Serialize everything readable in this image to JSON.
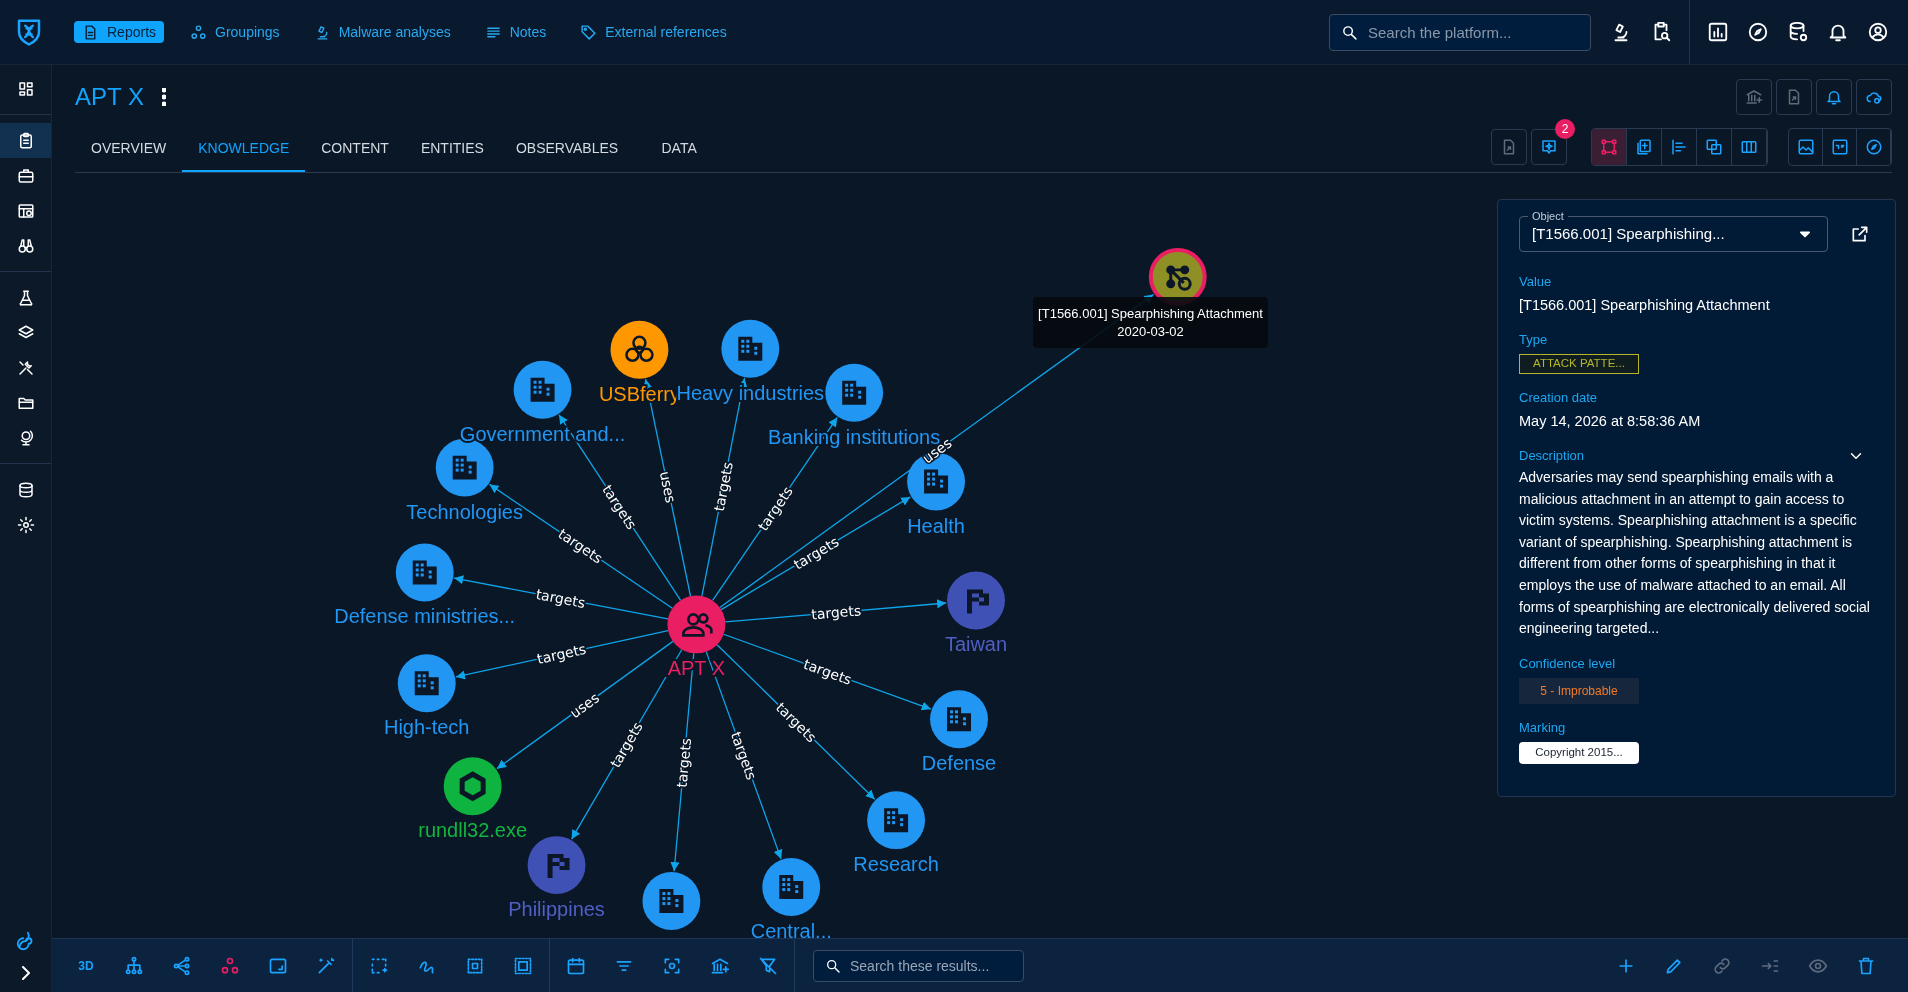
{
  "top_nav": {
    "items": [
      {
        "label": "Reports",
        "kind": "report",
        "selected": true
      },
      {
        "label": "Groupings",
        "kind": "circles",
        "selected": false
      },
      {
        "label": "Malware analyses",
        "kind": "microscope",
        "selected": false
      },
      {
        "label": "Notes",
        "kind": "lines",
        "selected": false
      },
      {
        "label": "External references",
        "kind": "tag",
        "selected": false
      }
    ],
    "search": {
      "placeholder": "Search the platform..."
    }
  },
  "sidebar": {
    "items": [
      {
        "kind": "dashboard",
        "selected": false
      },
      {
        "kind": "analyses",
        "selected": true
      },
      {
        "kind": "cases",
        "selected": false
      },
      {
        "kind": "events",
        "selected": false
      },
      {
        "kind": "observations",
        "selected": false
      },
      {
        "kind": "threats",
        "selected": false
      },
      {
        "kind": "arsenal",
        "selected": false
      },
      {
        "kind": "techniques",
        "selected": false
      },
      {
        "kind": "entities",
        "selected": false
      },
      {
        "kind": "locations",
        "selected": false
      },
      {
        "kind": "data",
        "selected": false
      },
      {
        "kind": "settings",
        "selected": false
      }
    ]
  },
  "report": {
    "title": "APT X",
    "actions": [
      {
        "kind": "bank-plus",
        "disabled": true
      },
      {
        "kind": "file-export",
        "disabled": true
      },
      {
        "kind": "bell",
        "disabled": false
      },
      {
        "kind": "cloud",
        "disabled": false
      }
    ]
  },
  "tabs": [
    {
      "label": "OVERVIEW",
      "selected": false
    },
    {
      "label": "KNOWLEDGE",
      "selected": true
    },
    {
      "label": "CONTENT",
      "selected": false
    },
    {
      "label": "ENTITIES",
      "selected": false
    },
    {
      "label": "OBSERVABLES",
      "selected": false
    },
    {
      "label": "DATA",
      "selected": false
    }
  ],
  "tab_tools": {
    "suggestions_badge": "2",
    "view_modes": [
      {
        "kind": "graph",
        "selected": true
      },
      {
        "kind": "content-mapping",
        "selected": false
      },
      {
        "kind": "timeline",
        "selected": false
      },
      {
        "kind": "correlation",
        "selected": false
      },
      {
        "kind": "matrix",
        "selected": false
      }
    ]
  },
  "graph": {
    "nodes": [
      {
        "kind": "threat-actor",
        "label": "APT X",
        "selected": false
      },
      {
        "kind": "malware",
        "label": "USBferry",
        "relation": "uses",
        "selected": false
      },
      {
        "kind": "sector",
        "label": "Heavy industries",
        "relation": "targets",
        "selected": false
      },
      {
        "kind": "sector",
        "label": "Government and...",
        "relation": "targets",
        "selected": false
      },
      {
        "kind": "sector",
        "label": "Banking institutions",
        "relation": "targets",
        "selected": false
      },
      {
        "kind": "sector",
        "label": "Technologies",
        "relation": "targets",
        "selected": false
      },
      {
        "kind": "sector",
        "label": "Health",
        "relation": "targets",
        "selected": false
      },
      {
        "kind": "sector",
        "label": "Defense ministries...",
        "relation": "targets",
        "selected": false
      },
      {
        "kind": "country",
        "label": "Taiwan",
        "relation": "targets",
        "selected": false
      },
      {
        "kind": "sector",
        "label": "High-tech",
        "relation": "targets",
        "selected": false
      },
      {
        "kind": "sector",
        "label": "Defense",
        "relation": "targets",
        "selected": false
      },
      {
        "kind": "file",
        "label": "rundll32.exe",
        "relation": "uses",
        "selected": false
      },
      {
        "kind": "sector",
        "label": "Research",
        "relation": "targets",
        "selected": false
      },
      {
        "kind": "country",
        "label": "Philippines",
        "relation": "targets",
        "selected": false
      },
      {
        "kind": "sector",
        "relation": "targets",
        "selected": false
      },
      {
        "kind": "sector",
        "label": "Central...",
        "relation": "targets",
        "selected": false
      },
      {
        "kind": "attack-pattern",
        "relation": "uses",
        "selected": true
      }
    ],
    "tooltip": {
      "title": "[T1566.001] Spearphishing Attachment",
      "date": "2020-03-02"
    }
  },
  "details": {
    "object": {
      "legend": "Object",
      "value": "[T1566.001] Spearphishing..."
    },
    "fields": [
      {
        "kind": "text",
        "label": "Value",
        "value": "[T1566.001] Spearphishing Attachment"
      },
      {
        "kind": "type-tag",
        "label": "Type",
        "value": "ATTACK PATTE..."
      },
      {
        "kind": "text",
        "label": "Creation date",
        "value": "May 14, 2026 at 8:58:36 AM"
      },
      {
        "kind": "description",
        "label": "Description",
        "value": "Adversaries may send spearphishing emails with a malicious attachment in an attempt to gain access to victim systems. Spearphishing attachment is a specific variant of spearphishing. Spearphishing attachment is different from other forms of spearphishing in that it employs the use of malware attached to an email. All forms of spearphishing are electronically delivered social engineering targeted...",
        "expanded": false
      },
      {
        "kind": "confidence-tag",
        "label": "Confidence level",
        "value": "5 - Improbable"
      },
      {
        "kind": "marking-chip",
        "label": "Marking",
        "value": "Copyright 2015..."
      }
    ]
  },
  "toolbar": {
    "mode_3d": "3D",
    "search": {
      "placeholder": "Search these results..."
    },
    "actions": [
      {
        "kind": "plus",
        "disabled": false
      },
      {
        "kind": "pencil",
        "disabled": false
      },
      {
        "kind": "link",
        "disabled": true
      },
      {
        "kind": "indent",
        "disabled": true
      },
      {
        "kind": "eye",
        "disabled": true
      },
      {
        "kind": "trash",
        "disabled": false
      }
    ]
  }
}
